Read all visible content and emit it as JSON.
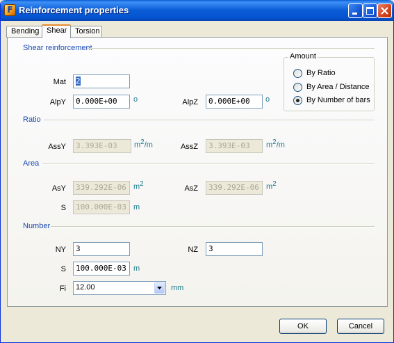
{
  "window": {
    "title": "Reinforcement properties"
  },
  "tabs": [
    {
      "label": "Bending",
      "active": false
    },
    {
      "label": "Shear",
      "active": true
    },
    {
      "label": "Torsion",
      "active": false
    }
  ],
  "shear_reinforcement": {
    "group_label": "Shear reinforcement",
    "mat_label": "Mat",
    "mat_value": "2",
    "alpy_label": "AlpY",
    "alpy_value": "0.000E+00",
    "alpy_unit": "o",
    "alpz_label": "AlpZ",
    "alpz_value": "0.000E+00",
    "alpz_unit": "o"
  },
  "amount": {
    "label": "Amount",
    "options": [
      {
        "label": "By Ratio",
        "selected": false
      },
      {
        "label": "By Area / Distance",
        "selected": false
      },
      {
        "label": "By Number of bars",
        "selected": true
      }
    ]
  },
  "ratio": {
    "group_label": "Ratio",
    "assy_label": "AssY",
    "assy_value": "3.393E-03",
    "assz_label": "AssZ",
    "assz_value": "3.393E-03",
    "unit_base": "m",
    "unit_exp": "2",
    "unit_suffix": "/m"
  },
  "area": {
    "group_label": "Area",
    "asy_label": "AsY",
    "asy_value": "339.292E-06",
    "asz_label": "AsZ",
    "asz_value": "339.292E-06",
    "area_unit_base": "m",
    "area_unit_exp": "2",
    "s_label": "S",
    "s_value": "100.000E-03",
    "s_unit": "m"
  },
  "number": {
    "group_label": "Number",
    "ny_label": "NY",
    "ny_value": "3",
    "nz_label": "NZ",
    "nz_value": "3",
    "s_label": "S",
    "s_value": "100.000E-03",
    "s_unit": "m",
    "fi_label": "Fi",
    "fi_value": "12.00",
    "fi_unit": "mm"
  },
  "buttons": {
    "ok": "OK",
    "cancel": "Cancel"
  }
}
